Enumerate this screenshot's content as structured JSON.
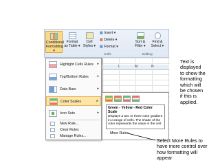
{
  "ribbon": {
    "conditional_formatting": [
      "Conditional",
      "Formatting ▾"
    ],
    "format_as_table": [
      "Format",
      "as Table ▾"
    ],
    "cell_styles": [
      "Cell",
      "Styles ▾"
    ],
    "insert": "Insert ▾",
    "delete": "Delete ▾",
    "format": "Format ▾",
    "sort_filter": [
      "Sort &",
      "Filter ▾"
    ],
    "find_select": [
      "Find &",
      "Select ▾"
    ],
    "group_cells": "Cells",
    "group_editing": "Editing"
  },
  "sheet": {
    "columns": [
      "L",
      "M",
      "N"
    ]
  },
  "menu": {
    "items": [
      {
        "label": "Highlight Cells Rules",
        "arrow": "▸"
      },
      {
        "label": "Top/Bottom Rules",
        "arrow": "▸"
      },
      {
        "label": "Data Bars",
        "arrow": "▸"
      },
      {
        "label": "Color Scales",
        "arrow": "▸"
      },
      {
        "label": "Icon Sets",
        "arrow": "▸"
      }
    ],
    "small_items": [
      "New Rule...",
      "Clear Rules",
      "Manage Rules..."
    ]
  },
  "submenu": {
    "tooltip_title": "Green - Yellow - Red Color Scale",
    "tooltip_body": "Displays a two or three color gradient in a range of cells. The shade of the color represents the value in the cell.",
    "more_rules": "More Rules..."
  },
  "annotations": {
    "right_note": [
      "Text is",
      "displayed",
      "to show the",
      "formatting",
      "which will",
      "be chosen",
      "if this is",
      "applied."
    ],
    "bottom_note": [
      "Select More Rules to",
      "have more control over",
      "how formatting will",
      "appear"
    ]
  },
  "colors": {
    "highlight": "#fde5a8",
    "ribbon_bg": "#dfe8f4",
    "scale_green": "#63be7b",
    "scale_yellow": "#ffeb84",
    "scale_red": "#f8696b"
  }
}
